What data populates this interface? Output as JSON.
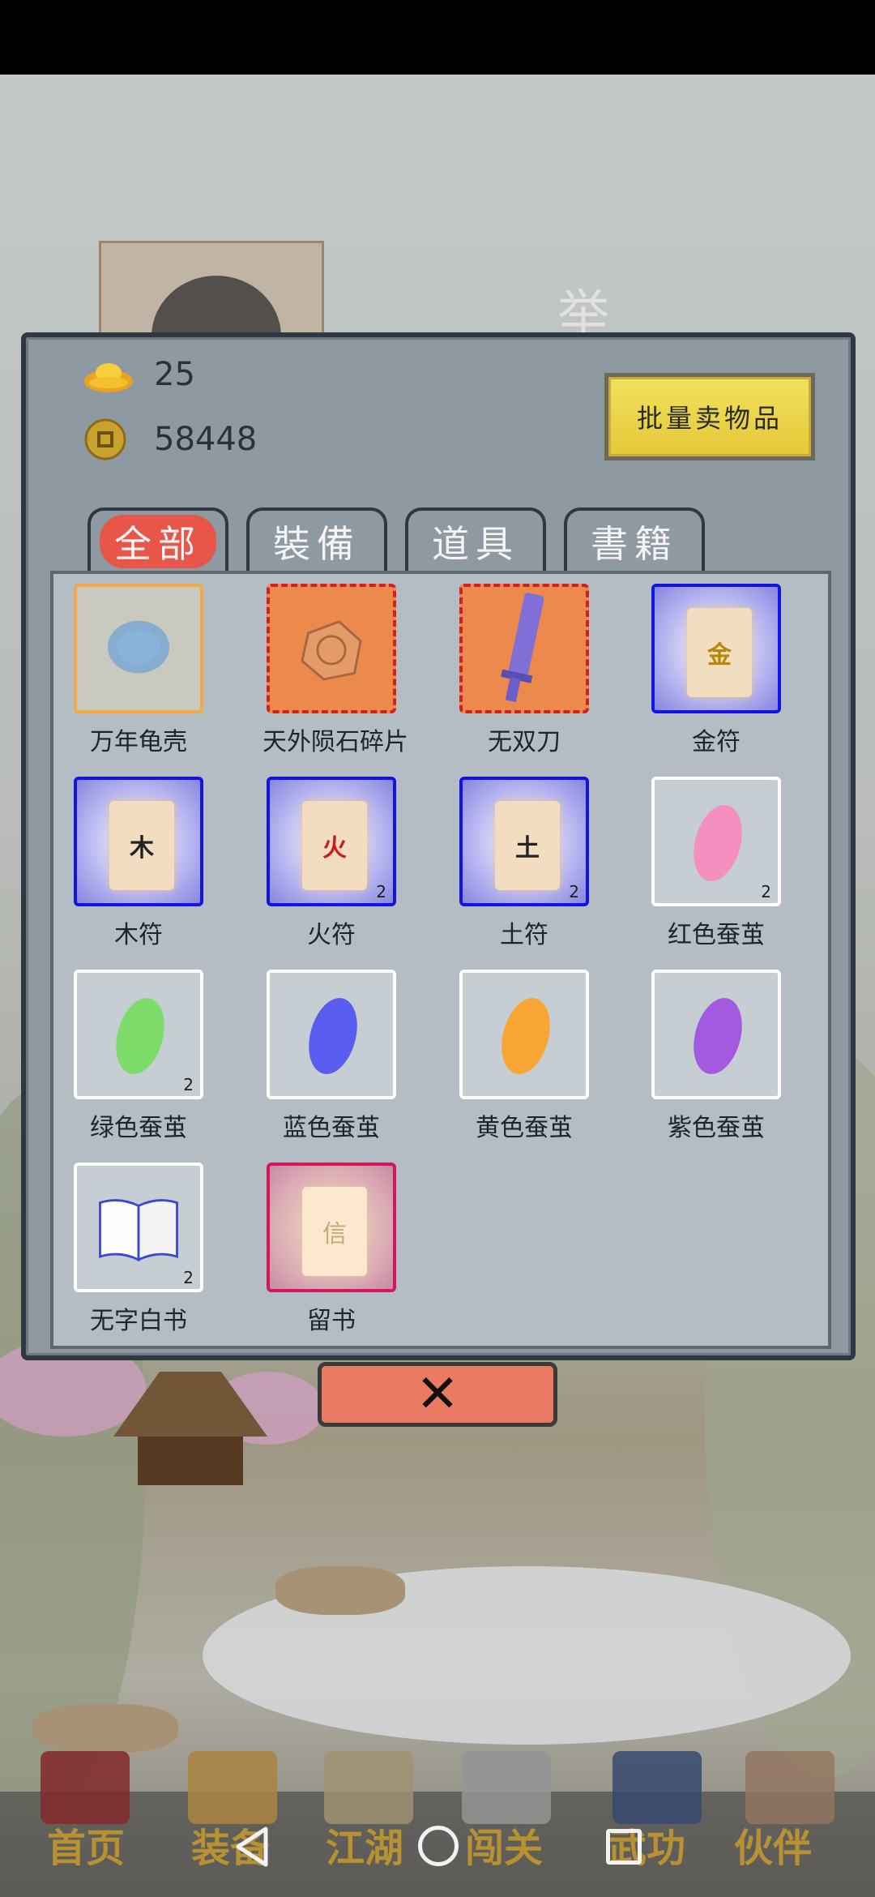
{
  "background": {
    "faded_char": "举",
    "bottom_menu": [
      "首页",
      "装备",
      "江湖",
      "闯关",
      "武功",
      "伙伴"
    ]
  },
  "currency": {
    "ingot": "25",
    "coins": "58448"
  },
  "sell_button": "批量卖物品",
  "tabs": [
    "全部",
    "裝備",
    "道具",
    "書籍"
  ],
  "items": [
    {
      "name": "万年龟壳",
      "quality": "orange",
      "count": "",
      "icon": "turtle-shell-icon"
    },
    {
      "name": "天外陨石碎片",
      "quality": "red",
      "count": "",
      "icon": "meteorite-icon"
    },
    {
      "name": "无双刀",
      "quality": "red",
      "count": "",
      "icon": "blade-icon"
    },
    {
      "name": "金符",
      "quality": "blue",
      "count": "",
      "icon": "talisman-icon",
      "glyph": "金"
    },
    {
      "name": "木符",
      "quality": "blue",
      "count": "",
      "icon": "talisman-icon",
      "glyph": "木"
    },
    {
      "name": "火符",
      "quality": "blue",
      "count": "2",
      "icon": "talisman-icon",
      "glyph": "火"
    },
    {
      "name": "土符",
      "quality": "blue",
      "count": "2",
      "icon": "talisman-icon",
      "glyph": "土"
    },
    {
      "name": "红色蚕茧",
      "quality": "white",
      "count": "2",
      "icon": "cocoon-icon",
      "color": "#f48fc0"
    },
    {
      "name": "绿色蚕茧",
      "quality": "white",
      "count": "2",
      "icon": "cocoon-icon",
      "color": "#7ddc6a"
    },
    {
      "name": "蓝色蚕茧",
      "quality": "white",
      "count": "",
      "icon": "cocoon-icon",
      "color": "#5a5ef0"
    },
    {
      "name": "黄色蚕茧",
      "quality": "white",
      "count": "",
      "icon": "cocoon-icon",
      "color": "#f7a634"
    },
    {
      "name": "紫色蚕茧",
      "quality": "white",
      "count": "",
      "icon": "cocoon-icon",
      "color": "#a35ae0"
    },
    {
      "name": "无字白书",
      "quality": "white",
      "count": "2",
      "icon": "book-icon"
    },
    {
      "name": "留书",
      "quality": "pink",
      "count": "",
      "icon": "letter-icon",
      "glyph": "信"
    }
  ],
  "close_label": "✕",
  "colors": {
    "dialog_bg": "#8f99a1",
    "active_tab": "#e8564a",
    "sell_button": "#f2e15e",
    "close_button": "#e97b63"
  }
}
